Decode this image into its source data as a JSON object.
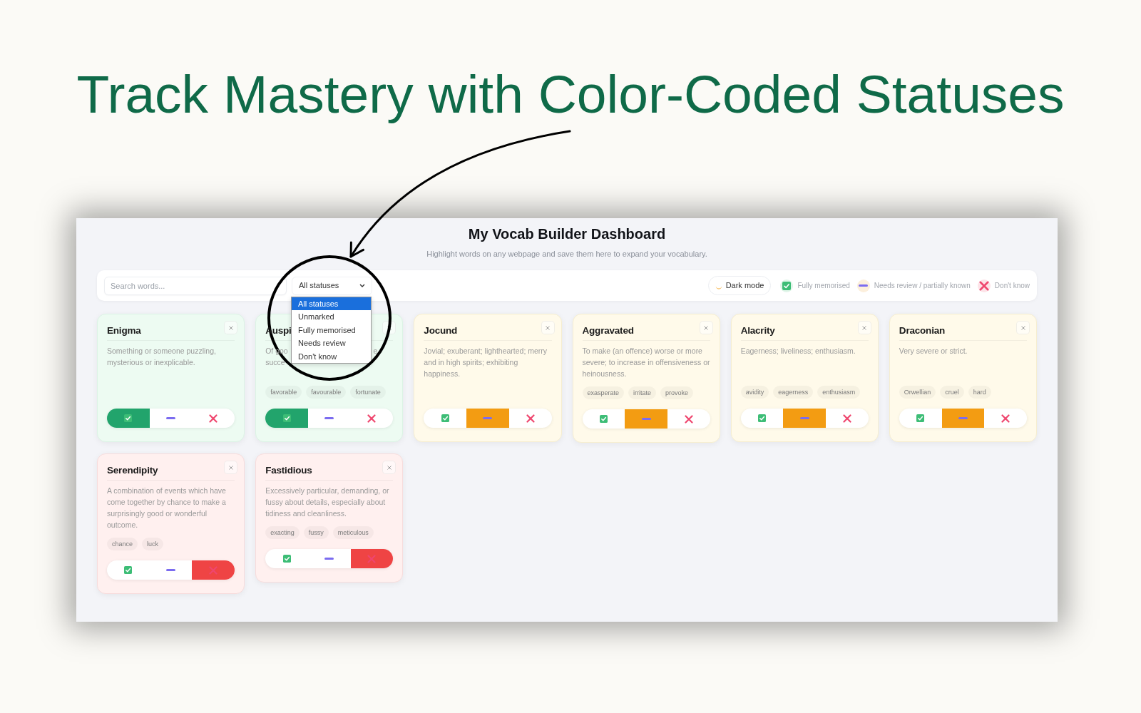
{
  "headline": "Track Mastery with Color-Coded Statuses",
  "dashboard": {
    "title": "My Vocab Builder Dashboard",
    "subtitle": "Highlight words on any webpage and save them here to expand your vocabulary.",
    "toolbar": {
      "search": {
        "placeholder": "Search words..."
      },
      "status_filter": {
        "value": "All statuses",
        "expanded": true,
        "options": [
          {
            "label": "All statuses",
            "selected": true
          },
          {
            "label": "Unmarked",
            "selected": false
          },
          {
            "label": "Fully memorised",
            "selected": false
          },
          {
            "label": "Needs review",
            "selected": false
          },
          {
            "label": "Don't know",
            "selected": false
          }
        ]
      },
      "dark_mode": {
        "label": "Dark mode"
      },
      "legend": [
        {
          "kind": "memorised",
          "label": "Fully memorised"
        },
        {
          "kind": "review",
          "label": "Needs review / partially known"
        },
        {
          "kind": "unknown",
          "label": "Don't know"
        }
      ]
    },
    "cards": [
      {
        "word": "Enigma",
        "definition": "Something or someone puzzling, mysterious or inexplicable.",
        "statuses": [
          {
            "kind": "memorised",
            "selected": true
          },
          {
            "kind": "review",
            "selected": false
          },
          {
            "kind": "unknown",
            "selected": false
          }
        ]
      },
      {
        "word": "Auspi",
        "definition_fragments": [
          [
            "Of goo",
            "e"
          ],
          [
            "succe"
          ]
        ],
        "synonyms": [
          "favorable",
          "favourable",
          "fortunate"
        ],
        "statuses": [
          {
            "kind": "memorised",
            "selected": true
          },
          {
            "kind": "review",
            "selected": false
          },
          {
            "kind": "unknown",
            "selected": false
          }
        ]
      },
      {
        "word": "Jocund",
        "definition": "Jovial; exuberant; lighthearted; merry and in high spirits; exhibiting happiness.",
        "statuses": [
          {
            "kind": "memorised",
            "selected": false
          },
          {
            "kind": "review",
            "selected": true
          },
          {
            "kind": "unknown",
            "selected": false
          }
        ]
      },
      {
        "word": "Aggravated",
        "definition": "To make (an offence) worse or more severe; to increase in offensiveness or heinousness.",
        "synonyms": [
          "exasperate",
          "irritate",
          "provoke"
        ],
        "statuses": [
          {
            "kind": "memorised",
            "selected": false
          },
          {
            "kind": "review",
            "selected": true
          },
          {
            "kind": "unknown",
            "selected": false
          }
        ]
      },
      {
        "word": "Alacrity",
        "definition": "Eagerness; liveliness; enthusiasm.",
        "synonyms": [
          "avidity",
          "eagerness",
          "enthusiasm"
        ],
        "statuses": [
          {
            "kind": "memorised",
            "selected": false
          },
          {
            "kind": "review",
            "selected": true
          },
          {
            "kind": "unknown",
            "selected": false
          }
        ]
      },
      {
        "word": "Draconian",
        "definition": "Very severe or strict.",
        "synonyms": [
          "Orwellian",
          "cruel",
          "hard"
        ],
        "statuses": [
          {
            "kind": "memorised",
            "selected": false
          },
          {
            "kind": "review",
            "selected": true
          },
          {
            "kind": "unknown",
            "selected": false
          }
        ]
      },
      {
        "word": "Serendipity",
        "definition": "A combination of events which have come together by chance to make a surprisingly good or wonderful outcome.",
        "synonyms": [
          "chance",
          "luck"
        ],
        "statuses": [
          {
            "kind": "memorised",
            "selected": false
          },
          {
            "kind": "review",
            "selected": false
          },
          {
            "kind": "unknown",
            "selected": true
          }
        ]
      },
      {
        "word": "Fastidious",
        "definition": "Excessively particular, demanding, or fussy about details, especially about tidiness and cleanliness.",
        "synonyms": [
          "exacting",
          "fussy",
          "meticulous"
        ],
        "statuses": [
          {
            "kind": "memorised",
            "selected": false
          },
          {
            "kind": "review",
            "selected": false
          },
          {
            "kind": "unknown",
            "selected": true
          }
        ]
      }
    ]
  }
}
